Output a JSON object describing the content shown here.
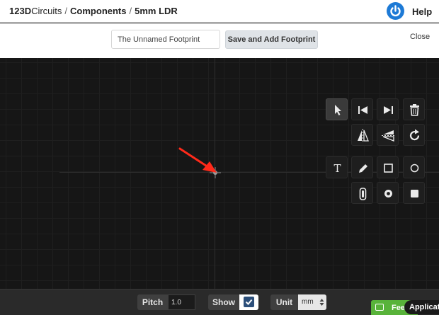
{
  "breadcrumb": {
    "brand_bold": "123D",
    "brand_rest": "Circuits",
    "separator": "/",
    "components": "Components",
    "current": "5mm LDR"
  },
  "header": {
    "help_label": "Help"
  },
  "toolbar": {
    "name_value": "The Unnamed Footprint",
    "save_label": "Save and Add Footprint",
    "close_label": "Close"
  },
  "tools": [
    {
      "name": "select-tool",
      "icon": "cursor-arrow-icon",
      "active": true
    },
    {
      "name": "first-tool",
      "icon": "skip-start-icon"
    },
    {
      "name": "last-tool",
      "icon": "skip-end-icon"
    },
    {
      "name": "delete-tool",
      "icon": "trash-icon"
    },
    {
      "name": "flip-horizontal-tool",
      "icon": "flip-horizontal-icon"
    },
    {
      "name": "flip-vertical-tool",
      "icon": "flip-vertical-icon"
    },
    {
      "name": "rotate-tool",
      "icon": "rotate-icon"
    },
    {
      "name": "text-tool",
      "icon": "text-icon",
      "glyph": "T"
    },
    {
      "name": "pencil-tool",
      "icon": "pencil-icon"
    },
    {
      "name": "rectangle-tool",
      "icon": "rectangle-icon"
    },
    {
      "name": "circle-tool",
      "icon": "circle-icon"
    },
    {
      "name": "pad-oblong-tool",
      "icon": "oblong-pad-icon"
    },
    {
      "name": "pad-round-tool",
      "icon": "round-pad-icon"
    },
    {
      "name": "pad-square-tool",
      "icon": "square-pad-icon"
    }
  ],
  "bottom": {
    "pitch_label": "Pitch",
    "pitch_value": "1.0",
    "show_label": "Show",
    "show_checked": true,
    "unit_label": "Unit",
    "unit_value": "mm",
    "feedback_label": "Fee",
    "application_label": "Applicat"
  },
  "colors": {
    "accent_blue": "#1d7ad6",
    "annotation_red": "#ff2a1a",
    "feedback_green": "#58b33a"
  }
}
